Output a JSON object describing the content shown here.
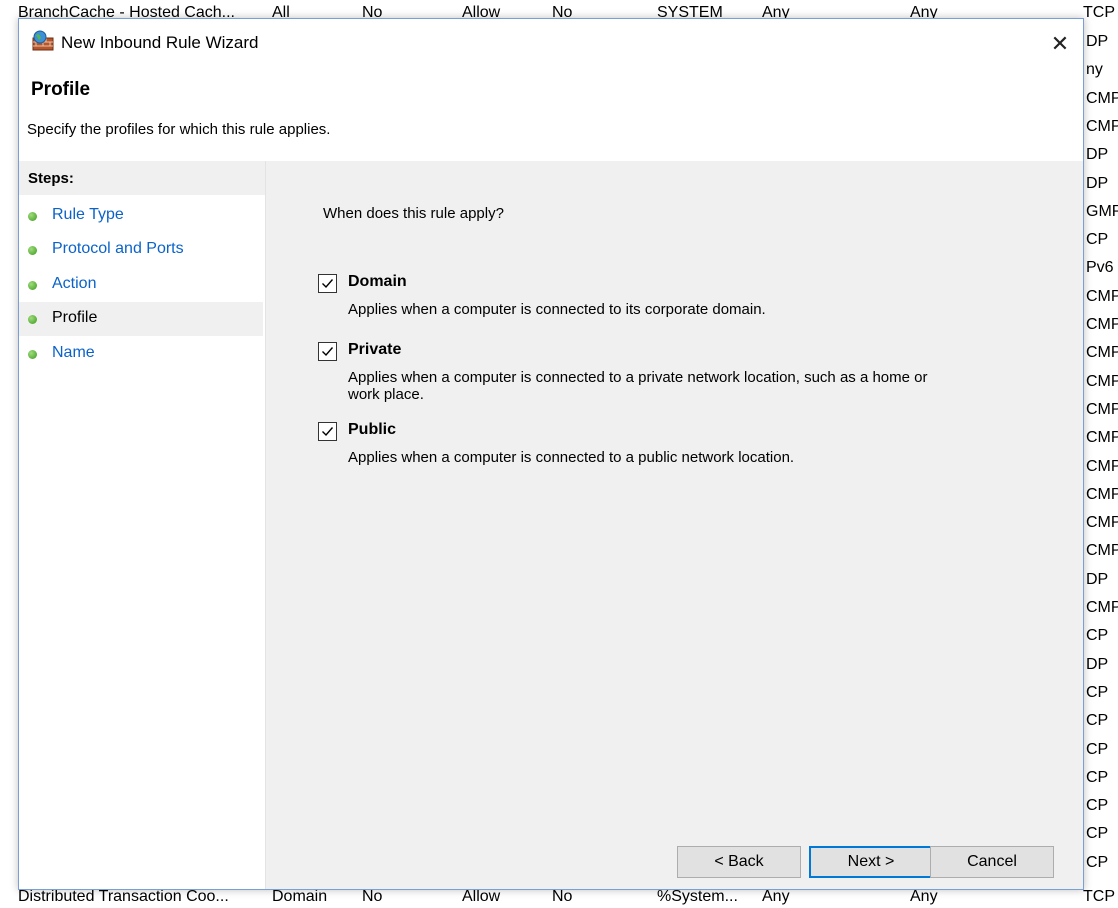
{
  "background": {
    "top_row": {
      "name": "BranchCache - Hosted Cach...",
      "profile": "All",
      "override": "No",
      "action": "Allow",
      "edge": "No",
      "program": "SYSTEM",
      "local": "Any",
      "remote": "Any",
      "protocol": "TCP"
    },
    "bottom_row": {
      "name": "Distributed Transaction Coo...",
      "profile": "Domain",
      "override": "No",
      "action": "Allow",
      "edge": "No",
      "program": "%System...",
      "local": "Any",
      "remote": "Any",
      "protocol": "TCP"
    },
    "right_column": [
      "DP",
      "ny",
      "CMP",
      "CMP",
      "DP",
      "DP",
      "GMP",
      "CP",
      "Pv6",
      "CMP",
      "CMP",
      "CMP",
      "CMP",
      "CMP",
      "CMP",
      "CMP",
      "CMP",
      "CMP",
      "CMP",
      "DP",
      "CMP",
      "CP",
      "DP",
      "CP",
      "CP",
      "CP",
      "CP",
      "CP",
      "CP",
      "CP"
    ]
  },
  "dialog": {
    "title": "New Inbound Rule Wizard",
    "close_glyph": "✕",
    "header_title": "Profile",
    "header_subtitle": "Specify the profiles for which this rule applies.",
    "steps_heading": "Steps:",
    "steps": [
      {
        "label": "Rule Type",
        "active": false
      },
      {
        "label": "Protocol and Ports",
        "active": false
      },
      {
        "label": "Action",
        "active": false
      },
      {
        "label": "Profile",
        "active": true
      },
      {
        "label": "Name",
        "active": false
      }
    ],
    "question": "When does this rule apply?",
    "options": [
      {
        "label": "Domain",
        "checked": true,
        "description": "Applies when a computer is connected to its corporate domain."
      },
      {
        "label": "Private",
        "checked": true,
        "description": "Applies when a computer is connected to a private network location, such as a home or work place."
      },
      {
        "label": "Public",
        "checked": true,
        "description": "Applies when a computer is connected to a public network location."
      }
    ],
    "buttons": {
      "back": "< Back",
      "next": "Next >",
      "cancel": "Cancel"
    }
  },
  "colors": {
    "link": "#0b63c9",
    "step_dot": "#3b9a1e",
    "content_bg": "#f0f0f0",
    "primary_border": "#0078d7"
  }
}
